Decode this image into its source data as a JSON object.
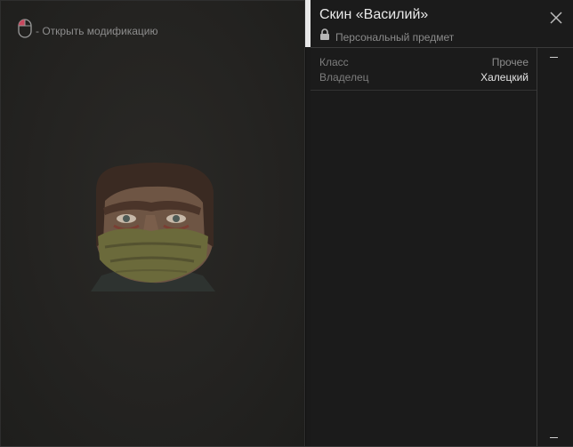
{
  "preview": {
    "hint_text": "- Открыть модификацию",
    "mouse_icon": "mouse-left-click-icon",
    "portrait_alt": "Character head portrait"
  },
  "item": {
    "title": "Скин «Василий»",
    "subtitle": "Персональный предмет",
    "lock_icon": "lock-icon",
    "close_icon": "close-icon"
  },
  "properties": [
    {
      "label": "Класс",
      "value": "Прочее"
    },
    {
      "label": "Владелец",
      "value": "Халецкий"
    }
  ],
  "colors": {
    "accent_bar": "#e8e8e8",
    "mouse_click_highlight": "#c8485e"
  }
}
